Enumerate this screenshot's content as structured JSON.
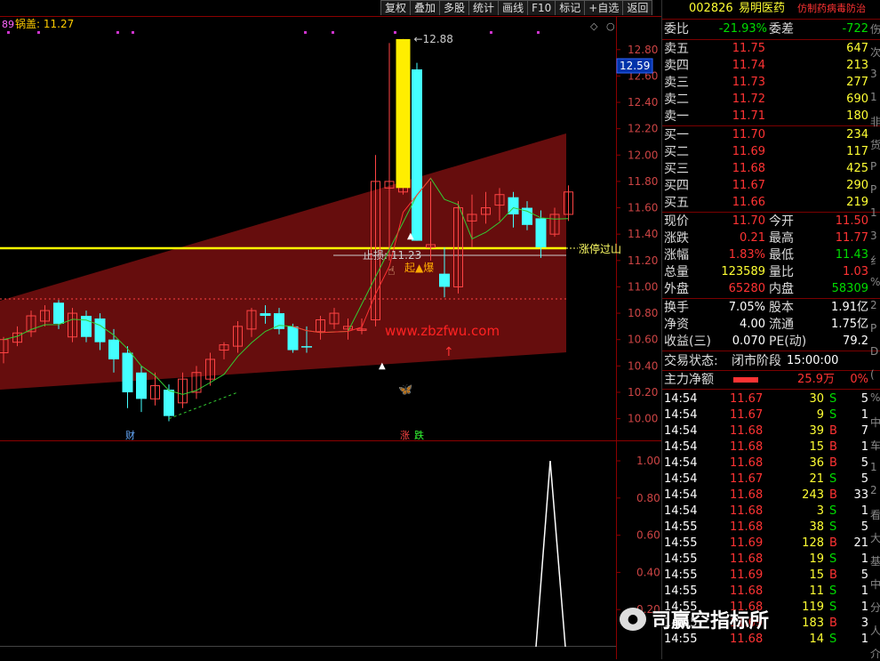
{
  "toolbar": [
    "复权",
    "叠加",
    "多股",
    "统计",
    "画线",
    "F10",
    "标记",
    "+自选",
    "返回"
  ],
  "indicator": {
    "prefix": "89",
    "name": "锅盖",
    "value": "11.27"
  },
  "annotations": {
    "top_price": "12.88",
    "stop": "止损: 11.23",
    "zt_line": "涨停过山",
    "qibao": "起▲爆",
    "watermark": "www.zbzfwu.com",
    "cai": "财",
    "zhang": "涨",
    "die": "跌",
    "current_price_tag": "12.59",
    "logo_text": "司赢空指标所"
  },
  "chart_data": [
    {
      "type": "candlestick",
      "yaxis_ticks": [
        "12.80",
        "12.60",
        "12.40",
        "12.20",
        "12.00",
        "11.80",
        "11.60",
        "11.40",
        "11.20",
        "11.00",
        "10.80",
        "10.60",
        "10.40",
        "10.20",
        "10.00"
      ],
      "ylim": [
        9.95,
        12.92
      ],
      "candles": [
        [
          10.5,
          10.6,
          10.42,
          10.62
        ],
        [
          10.58,
          10.65,
          10.55,
          10.7
        ],
        [
          10.66,
          10.78,
          10.62,
          10.82
        ],
        [
          10.74,
          10.82,
          10.7,
          10.86
        ],
        [
          10.88,
          10.72,
          10.68,
          10.9
        ],
        [
          10.62,
          10.8,
          10.58,
          10.84
        ],
        [
          10.78,
          10.62,
          10.58,
          10.82
        ],
        [
          10.76,
          10.58,
          10.52,
          10.8
        ],
        [
          10.6,
          10.45,
          10.35,
          10.68
        ],
        [
          10.5,
          10.2,
          10.08,
          10.55
        ],
        [
          10.35,
          10.15,
          10.05,
          10.4
        ],
        [
          10.15,
          10.25,
          10.1,
          10.35
        ],
        [
          10.22,
          10.02,
          9.98,
          10.26
        ],
        [
          10.12,
          10.3,
          10.08,
          10.35
        ],
        [
          10.2,
          10.35,
          10.15,
          10.4
        ],
        [
          10.3,
          10.45,
          10.25,
          10.5
        ],
        [
          10.52,
          10.56,
          10.45,
          10.58
        ],
        [
          10.55,
          10.7,
          10.5,
          10.74
        ],
        [
          10.68,
          10.82,
          10.62,
          10.84
        ],
        [
          10.8,
          10.78,
          10.72,
          10.86
        ],
        [
          10.8,
          10.68,
          10.64,
          10.84
        ],
        [
          10.7,
          10.52,
          10.5,
          10.72
        ],
        [
          10.55,
          10.54,
          10.5,
          10.7
        ],
        [
          10.66,
          10.75,
          10.6,
          10.78
        ],
        [
          10.72,
          10.8,
          10.68,
          10.84
        ],
        [
          10.68,
          10.7,
          10.6,
          10.76
        ],
        [
          10.68,
          10.68,
          10.64,
          10.76
        ],
        [
          10.75,
          11.8,
          10.7,
          12.0
        ],
        [
          11.75,
          11.8,
          11.2,
          12.85
        ],
        [
          11.72,
          12.85,
          11.7,
          12.88
        ],
        [
          12.65,
          11.35,
          11.35,
          12.7
        ],
        [
          11.3,
          11.32,
          11.2,
          11.8
        ],
        [
          11.1,
          11.0,
          10.92,
          11.3
        ],
        [
          11.0,
          11.6,
          10.95,
          11.65
        ],
        [
          11.5,
          11.55,
          11.3,
          11.7
        ],
        [
          11.55,
          11.6,
          11.48,
          11.72
        ],
        [
          11.62,
          11.7,
          11.5,
          11.75
        ],
        [
          11.68,
          11.55,
          11.45,
          11.72
        ],
        [
          11.6,
          11.47,
          11.43,
          11.65
        ],
        [
          11.52,
          11.3,
          11.22,
          11.58
        ],
        [
          11.4,
          11.55,
          11.38,
          11.6
        ],
        [
          11.55,
          11.72,
          11.5,
          11.77
        ]
      ],
      "bull_color": "#ff4444",
      "bear_color": "#44ffff"
    },
    {
      "type": "line",
      "yaxis_ticks": [
        "1.00",
        "0.80",
        "0.60",
        "0.40",
        "0.20"
      ],
      "ylim": [
        0,
        1.07
      ],
      "values": [
        0,
        0,
        0,
        0,
        0,
        0,
        0,
        0,
        0,
        0,
        0,
        0,
        0,
        0,
        0,
        0,
        0,
        0,
        0,
        0,
        0,
        0,
        0,
        0,
        0,
        0,
        0,
        0,
        0,
        0,
        0,
        0,
        0,
        0,
        0,
        0,
        0,
        0,
        1,
        0,
        0,
        0
      ],
      "color": "#ffffff"
    }
  ],
  "quote": {
    "code": "002826",
    "name": "易明医药",
    "concept": "仿制药病毒防治",
    "weibi_label": "委比",
    "weibi": "-21.93%",
    "weicha_label": "委差",
    "weicha": "-722",
    "asks": [
      [
        "卖五",
        "11.75",
        "647"
      ],
      [
        "卖四",
        "11.74",
        "213"
      ],
      [
        "卖三",
        "11.73",
        "277"
      ],
      [
        "卖二",
        "11.72",
        "690"
      ],
      [
        "卖一",
        "11.71",
        "180"
      ]
    ],
    "bids": [
      [
        "买一",
        "11.70",
        "234"
      ],
      [
        "买二",
        "11.69",
        "117"
      ],
      [
        "买三",
        "11.68",
        "425"
      ],
      [
        "买四",
        "11.67",
        "290"
      ],
      [
        "买五",
        "11.66",
        "219"
      ]
    ],
    "stats": [
      [
        "现价",
        "11.70",
        "今开",
        "11.50"
      ],
      [
        "涨跌",
        "0.21",
        "最高",
        "11.77"
      ],
      [
        "涨幅",
        "1.83%",
        "最低",
        "11.43"
      ],
      [
        "总量",
        "123589",
        "量比",
        "1.03"
      ],
      [
        "外盘",
        "65280",
        "内盘",
        "58309"
      ]
    ],
    "stats2": [
      [
        "换手",
        "7.05%",
        "股本",
        "1.91亿"
      ],
      [
        "净资",
        "4.00",
        "流通",
        "1.75亿"
      ],
      [
        "收益(三)",
        "0.070",
        "PE(动)",
        "79.2"
      ]
    ],
    "status_label": "交易状态:",
    "status": "闭市阶段",
    "status_time": "15:00:00",
    "main_label": "主力净额",
    "main_value": "25.9万",
    "main_pct": "0%"
  },
  "ticks": [
    [
      "14:54",
      "11.67",
      "30",
      "S",
      "5"
    ],
    [
      "14:54",
      "11.67",
      "9",
      "S",
      "1"
    ],
    [
      "14:54",
      "11.68",
      "39",
      "B",
      "7"
    ],
    [
      "14:54",
      "11.68",
      "15",
      "B",
      "1"
    ],
    [
      "14:54",
      "11.68",
      "36",
      "B",
      "5"
    ],
    [
      "14:54",
      "11.67",
      "21",
      "S",
      "5"
    ],
    [
      "14:54",
      "11.68",
      "243",
      "B",
      "33"
    ],
    [
      "14:54",
      "11.68",
      "3",
      "S",
      "1"
    ],
    [
      "14:55",
      "11.68",
      "38",
      "S",
      "5"
    ],
    [
      "14:55",
      "11.69",
      "128",
      "B",
      "21"
    ],
    [
      "14:55",
      "11.68",
      "19",
      "S",
      "1"
    ],
    [
      "14:55",
      "11.69",
      "15",
      "B",
      "5"
    ],
    [
      "14:55",
      "11.68",
      "11",
      "S",
      "1"
    ],
    [
      "14:55",
      "11.68",
      "119",
      "S",
      "1"
    ],
    [
      "14:55",
      "11.69",
      "183",
      "B",
      "3"
    ],
    [
      "14:55",
      "11.68",
      "14",
      "S",
      "1"
    ]
  ],
  "side_strip": [
    "伤",
    "次",
    "3",
    "1",
    "非",
    "货",
    "P",
    "P",
    "1",
    "3",
    "纟",
    "%",
    "2",
    "P",
    "D",
    "(",
    "%",
    "中",
    "车",
    "1",
    "2",
    "看",
    "大",
    "基",
    "中",
    "分",
    "人",
    "介"
  ]
}
